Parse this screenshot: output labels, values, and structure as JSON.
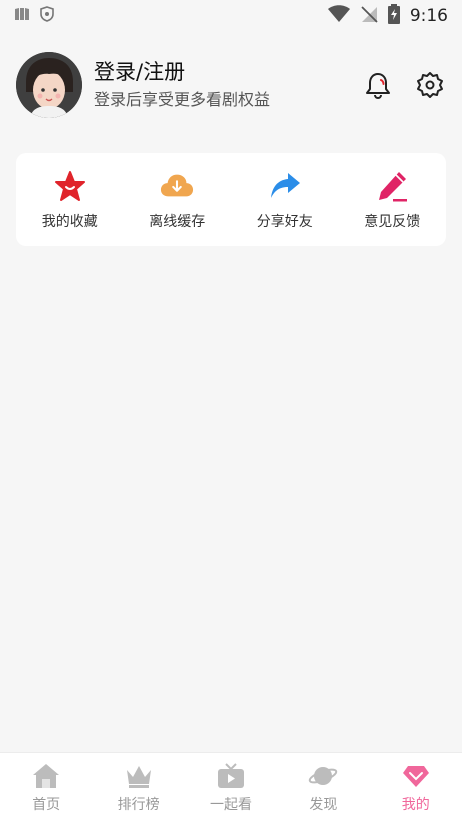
{
  "status_bar": {
    "time": "9:16",
    "icons": [
      "sim-card-icon",
      "shield-icon",
      "wifi-icon",
      "no-signal-icon",
      "battery-charging-icon"
    ]
  },
  "profile": {
    "title": "登录/注册",
    "subtitle": "登录后享受更多看剧权益",
    "avatar_icon": "avatar-illustration",
    "notification_icon": "bell-icon",
    "settings_icon": "gear-icon"
  },
  "quick_actions": [
    {
      "label": "我的收藏",
      "icon": "star-icon",
      "color": "#e0242b"
    },
    {
      "label": "离线缓存",
      "icon": "cloud-download-icon",
      "color": "#f0a64f"
    },
    {
      "label": "分享好友",
      "icon": "share-arrow-icon",
      "color": "#2b8de8"
    },
    {
      "label": "意见反馈",
      "icon": "pencil-icon",
      "color": "#e02466"
    }
  ],
  "tabs": [
    {
      "label": "首页",
      "icon": "home-icon",
      "active": false
    },
    {
      "label": "排行榜",
      "icon": "crown-icon",
      "active": false
    },
    {
      "label": "一起看",
      "icon": "tv-icon",
      "active": false
    },
    {
      "label": "发现",
      "icon": "planet-icon",
      "active": false
    },
    {
      "label": "我的",
      "icon": "diamond-icon",
      "active": true
    }
  ],
  "colors": {
    "accent": "#f0679b",
    "inactive_tab": "#bcbcbc",
    "background": "#f6f6f6"
  }
}
